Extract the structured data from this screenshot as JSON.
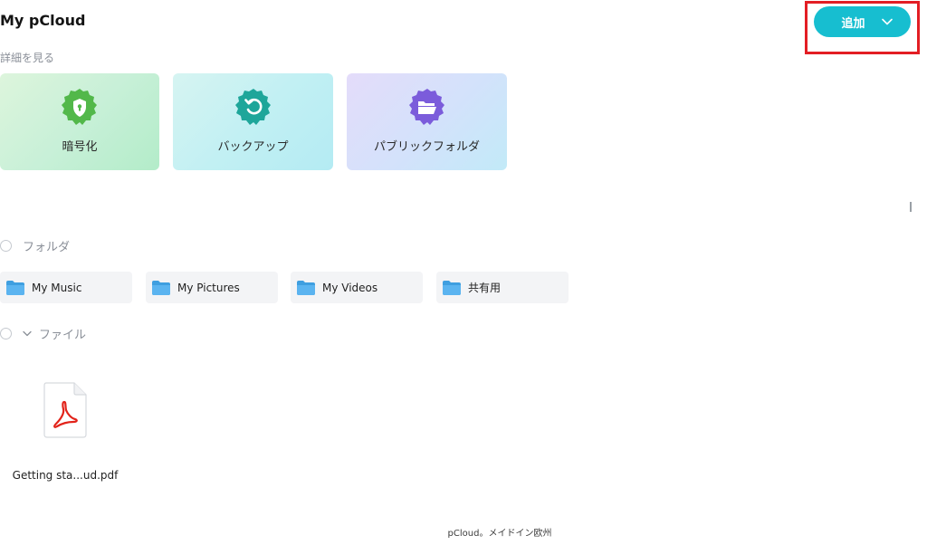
{
  "header": {
    "title": "My pCloud",
    "see_more": "詳細を見る",
    "add_button_label": "追加"
  },
  "feature_cards": [
    {
      "label": "暗号化",
      "icon": "shield-lock-icon",
      "color": "#52b84a"
    },
    {
      "label": "バックアップ",
      "icon": "restore-icon",
      "color": "#1ea69a"
    },
    {
      "label": "パブリックフォルダ",
      "icon": "folder-open-icon",
      "color": "#7b5cdb"
    }
  ],
  "folders_section": {
    "label": "フォルダ",
    "items": [
      {
        "name": "My Music"
      },
      {
        "name": "My Pictures"
      },
      {
        "name": "My Videos"
      },
      {
        "name": "共有用"
      }
    ]
  },
  "files_section": {
    "label": "ファイル",
    "items": [
      {
        "name": "Getting sta...ud.pdf",
        "icon": "pdf-file-icon"
      }
    ]
  },
  "footer": {
    "text": "pCloud。メイドイン欧州"
  },
  "colors": {
    "accent": "#17bed0",
    "highlight": "#e31e24",
    "folder": "#4aa8e8",
    "pdf": "#e2231a"
  }
}
